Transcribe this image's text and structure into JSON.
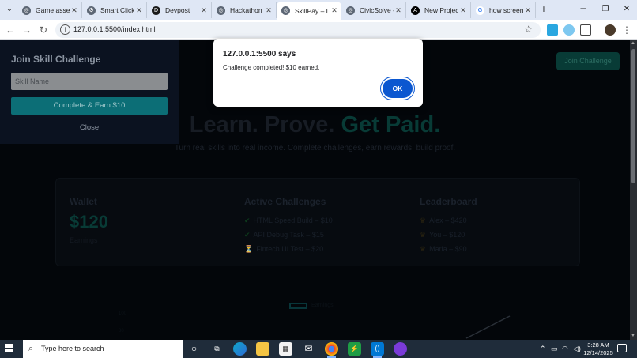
{
  "browser": {
    "tabs": [
      {
        "label": "Game asset",
        "icon": "globe-icon",
        "active": false
      },
      {
        "label": "Smart Click",
        "icon": "gear-icon",
        "active": false
      },
      {
        "label": "Devpost",
        "icon": "devpost-icon",
        "active": false
      },
      {
        "label": "Hackathon p",
        "icon": "globe-icon",
        "active": false
      },
      {
        "label": "SkillPay – Le",
        "icon": "globe-icon",
        "active": true
      },
      {
        "label": "CivicSolve -",
        "icon": "globe-icon",
        "active": false
      },
      {
        "label": "New Project",
        "icon": "a-logo-icon",
        "active": false
      },
      {
        "label": "how screen",
        "icon": "google-icon",
        "active": false
      }
    ],
    "url": "127.0.0.1:5500/index.html"
  },
  "page": {
    "hero_cta": "Join Challenge",
    "title_part1": "Learn. Prove. ",
    "title_highlight": "Get Paid.",
    "subtitle": "Turn real skills into real income. Complete challenges, earn rewards, build proof.",
    "wallet": {
      "heading": "Wallet",
      "amount": "$120",
      "label": "Earnings"
    },
    "challenges": {
      "heading": "Active Challenges",
      "items": [
        {
          "icon": "check-icon",
          "text": "HTML Speed Build – $10"
        },
        {
          "icon": "check-icon",
          "text": "API Debug Task – $15"
        },
        {
          "icon": "hourglass-icon",
          "text": "Fintech UI Test – $20"
        }
      ]
    },
    "leaderboard": {
      "heading": "Leaderboard",
      "items": [
        {
          "icon": "trophy-icon",
          "text": "Alex – $420"
        },
        {
          "icon": "trophy-icon",
          "text": "You – $120"
        },
        {
          "icon": "trophy-icon",
          "text": "Maria – $90"
        }
      ]
    },
    "chart_legend": "Earnings",
    "chart_ticks": [
      "100",
      "80"
    ]
  },
  "modal": {
    "title": "Join Skill Challenge",
    "input_placeholder": "Skill Name",
    "submit_label": "Complete & Earn $10",
    "close_label": "Close"
  },
  "alert": {
    "title": "127.0.0.1:5500 says",
    "message": "Challenge completed! $10 earned.",
    "ok_label": "OK"
  },
  "taskbar": {
    "search_placeholder": "Type here to search",
    "time": "3:28 AM",
    "date": "12/14/2025"
  },
  "colors": {
    "accent": "#0b57d0",
    "teal": "#0c6e76",
    "taskbar": "#1f2c3a"
  }
}
